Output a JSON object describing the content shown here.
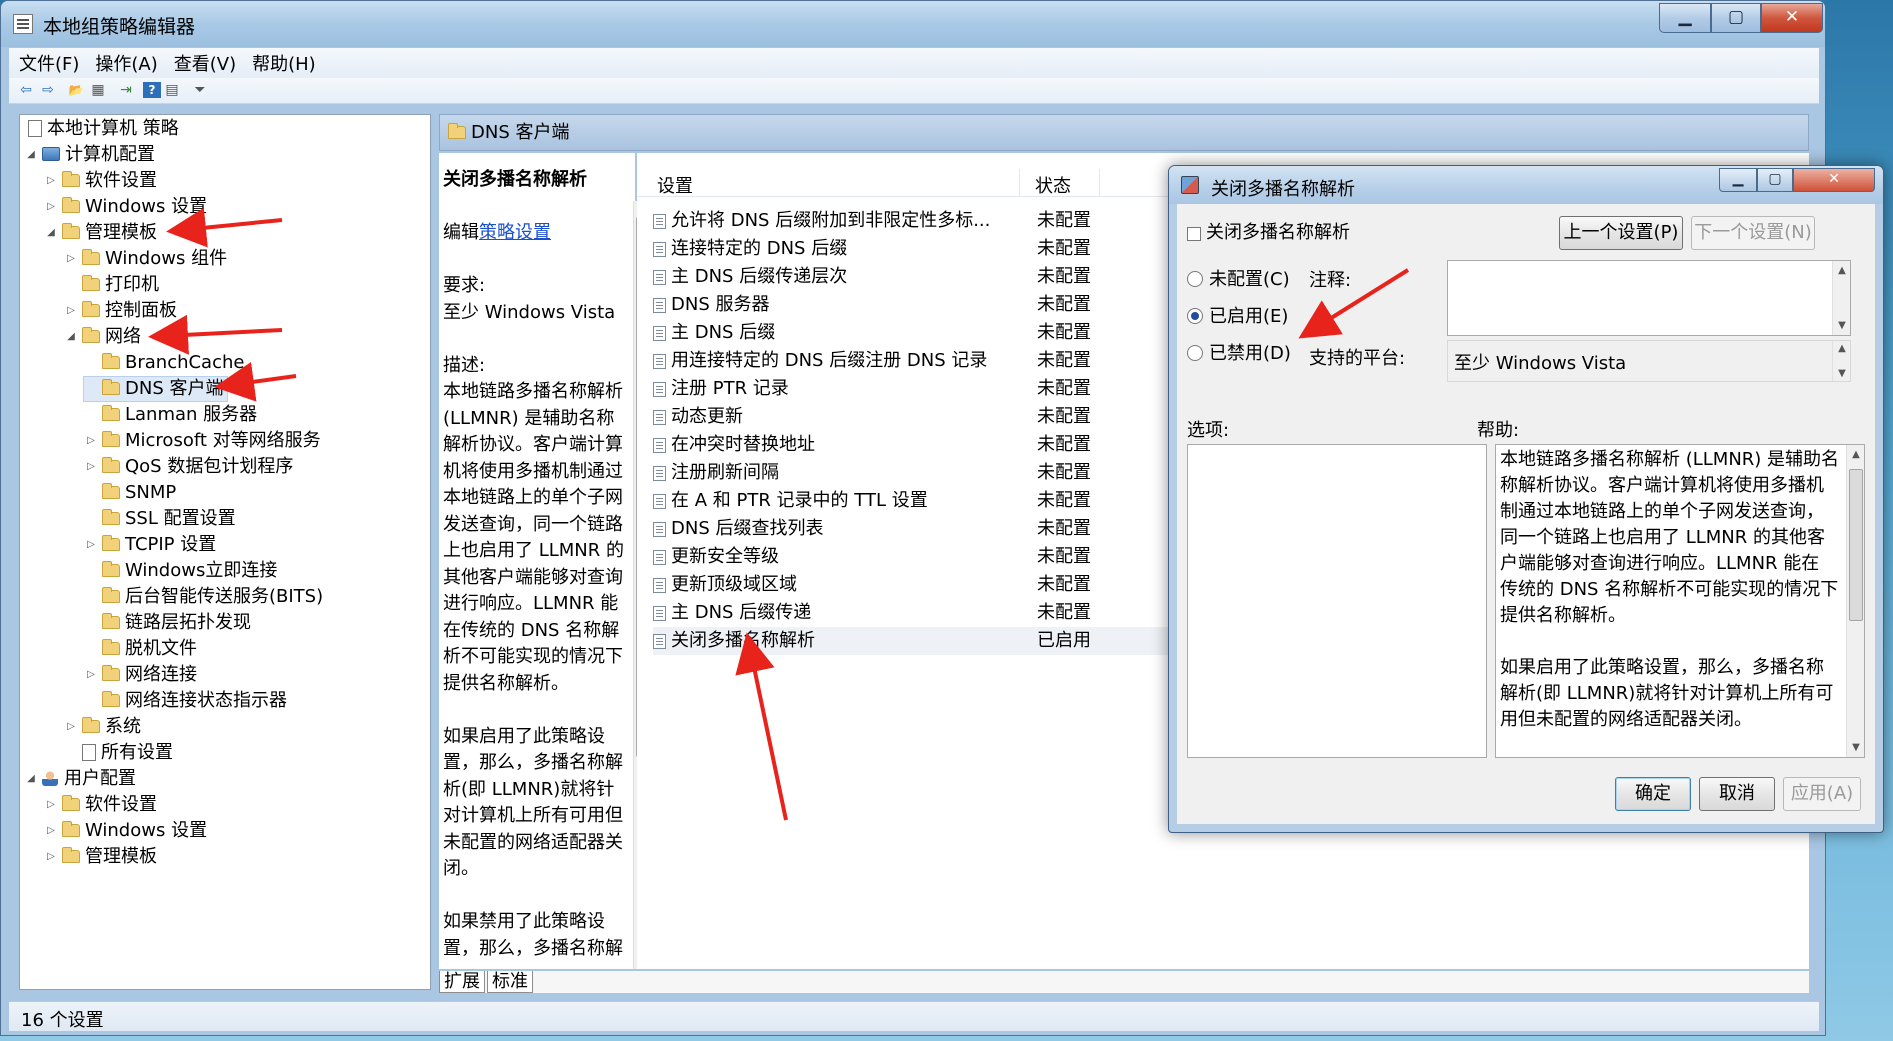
{
  "window": {
    "title": "本地组策略编辑器",
    "min_label": "▁",
    "max_label": "▢",
    "close_label": "✕"
  },
  "menu": [
    "文件(F)",
    "操作(A)",
    "查看(V)",
    "帮助(H)"
  ],
  "toolbar": {
    "icons": [
      "back-arrow-icon",
      "forward-arrow-icon",
      "up-folder-icon",
      "show-hide-tree-icon",
      "export-list-icon",
      "help-icon",
      "properties-icon",
      "filter-icon"
    ],
    "glyphs": [
      "⇦",
      "⇨",
      "📂",
      "▦",
      "⇥",
      "?",
      "▤",
      "⏷"
    ]
  },
  "tree": {
    "root": "本地计算机 策略",
    "computer_config": "计算机配置",
    "software_settings": "软件设置",
    "windows_settings": "Windows 设置",
    "admin_templates": "管理模板",
    "windows_components": "Windows 组件",
    "printers": "打印机",
    "control_panel": "控制面板",
    "network": "网络",
    "branchcache": "BranchCache",
    "dns_client": "DNS 客户端",
    "lanman_server": "Lanman 服务器",
    "ms_p2p": "Microsoft 对等网络服务",
    "qos": "QoS 数据包计划程序",
    "snmp": "SNMP",
    "ssl": "SSL 配置设置",
    "tcpip": "TCPIP 设置",
    "windows_connect_now": "Windows立即连接",
    "bits": "后台智能传送服务(BITS)",
    "lltd": "链路层拓扑发现",
    "offline_files": "脱机文件",
    "net_connections": "网络连接",
    "ncsi": "网络连接状态指示器",
    "system": "系统",
    "all_settings": "所有设置",
    "user_config": "用户配置",
    "u_software_settings": "软件设置",
    "u_windows_settings": "Windows 设置",
    "u_admin_templates": "管理模板"
  },
  "content_header": "DNS 客户端",
  "description": {
    "title": "关闭多播名称解析",
    "edit_prefix": "编辑",
    "edit_link": "策略设置",
    "req_label": "要求:",
    "req_value": "至少 Windows Vista",
    "desc_label": "描述:",
    "lines": [
      "本地链路多播名称解析",
      "(LLMNR) 是辅助名称",
      "解析协议。客户端计算",
      "机将使用多播机制通过",
      "本地链路上的单个子网",
      "发送查询，同一个链路",
      "上也启用了 LLMNR 的",
      "其他客户端能够对查询",
      "进行响应。LLMNR 能",
      "在传统的 DNS 名称解",
      "析不可能实现的情况下",
      "提供名称解析。"
    ],
    "lines2": [
      "如果启用了此策略设",
      "置，那么，多播名称解",
      "析(即 LLMNR)就将针",
      "对计算机上所有可用但",
      "未配置的网络适配器关",
      "闭。"
    ],
    "lines3": [
      "如果禁用了此策略设",
      "置，那么，多播名称解"
    ]
  },
  "list": {
    "col_setting": "设置",
    "col_state": "状态",
    "rows": [
      {
        "name": "允许将 DNS 后缀附加到非限定性多标...",
        "state": "未配置"
      },
      {
        "name": "连接特定的 DNS 后缀",
        "state": "未配置"
      },
      {
        "name": "主 DNS 后缀传递层次",
        "state": "未配置"
      },
      {
        "name": "DNS 服务器",
        "state": "未配置"
      },
      {
        "name": "主 DNS 后缀",
        "state": "未配置"
      },
      {
        "name": "用连接特定的 DNS 后缀注册 DNS 记录",
        "state": "未配置"
      },
      {
        "name": "注册 PTR 记录",
        "state": "未配置"
      },
      {
        "name": "动态更新",
        "state": "未配置"
      },
      {
        "name": "在冲突时替换地址",
        "state": "未配置"
      },
      {
        "name": "注册刷新间隔",
        "state": "未配置"
      },
      {
        "name": "在 A 和 PTR 记录中的 TTL 设置",
        "state": "未配置"
      },
      {
        "name": "DNS 后缀查找列表",
        "state": "未配置"
      },
      {
        "name": "更新安全等级",
        "state": "未配置"
      },
      {
        "name": "更新顶级域区域",
        "state": "未配置"
      },
      {
        "name": "主 DNS 后缀传递",
        "state": "未配置"
      },
      {
        "name": "关闭多播名称解析",
        "state": "已启用"
      }
    ]
  },
  "tabs": [
    "扩展",
    "标准"
  ],
  "status": "16 个设置",
  "dialog": {
    "title": "关闭多播名称解析",
    "header": "关闭多播名称解析",
    "prev_button": "上一个设置(P)",
    "next_button": "下一个设置(N)",
    "not_configured": "未配置(C)",
    "enabled": "已启用(E)",
    "disabled": "已禁用(D)",
    "selected_option": "已启用(E)",
    "comment_label": "注释:",
    "comment_value": "",
    "platform_label": "支持的平台:",
    "platform_value": "至少 Windows Vista",
    "options_label": "选项:",
    "help_label": "帮助:",
    "help_lines": [
      "本地链路多播名称解析 (LLMNR) 是辅助名",
      "称解析协议。客户端计算机将使用多播机",
      "制通过本地链路上的单个子网发送查询，",
      "同一个链路上也启用了 LLMNR 的其他客",
      "户端能够对查询进行响应。LLMNR 能在",
      "传统的 DNS 名称解析不可能实现的情况下",
      "提供名称解析。",
      "",
      "如果启用了此策略设置，那么，多播名称",
      "解析(即 LLMNR)就将针对计算机上所有可",
      "用但未配置的网络适配器关闭。"
    ],
    "ok": "确定",
    "cancel": "取消",
    "apply": "应用(A)"
  },
  "colors": {
    "annotation_arrow": "#e8231b",
    "selection": "#dde9f7",
    "link": "#1a4fd0"
  }
}
